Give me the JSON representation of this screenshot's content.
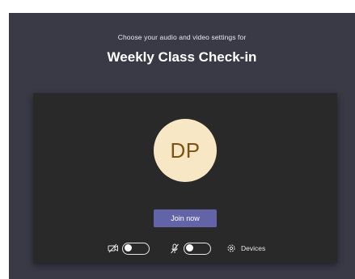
{
  "prejoin": {
    "subtitle": "Choose your audio and video settings for",
    "meeting_title": "Weekly Class Check-in",
    "avatar_initials": "DP",
    "join_label": "Join now",
    "devices_label": "Devices",
    "camera_toggle_on": false,
    "mic_toggle_on": false,
    "colors": {
      "background": "#3a3a47",
      "preview": "#292929",
      "avatar_bg": "#f8e7c5",
      "avatar_text": "#7a5414",
      "accent": "#6264a7"
    },
    "icons": {
      "camera": "camera-off-icon",
      "mic": "mic-off-icon",
      "devices": "gear-icon"
    }
  }
}
